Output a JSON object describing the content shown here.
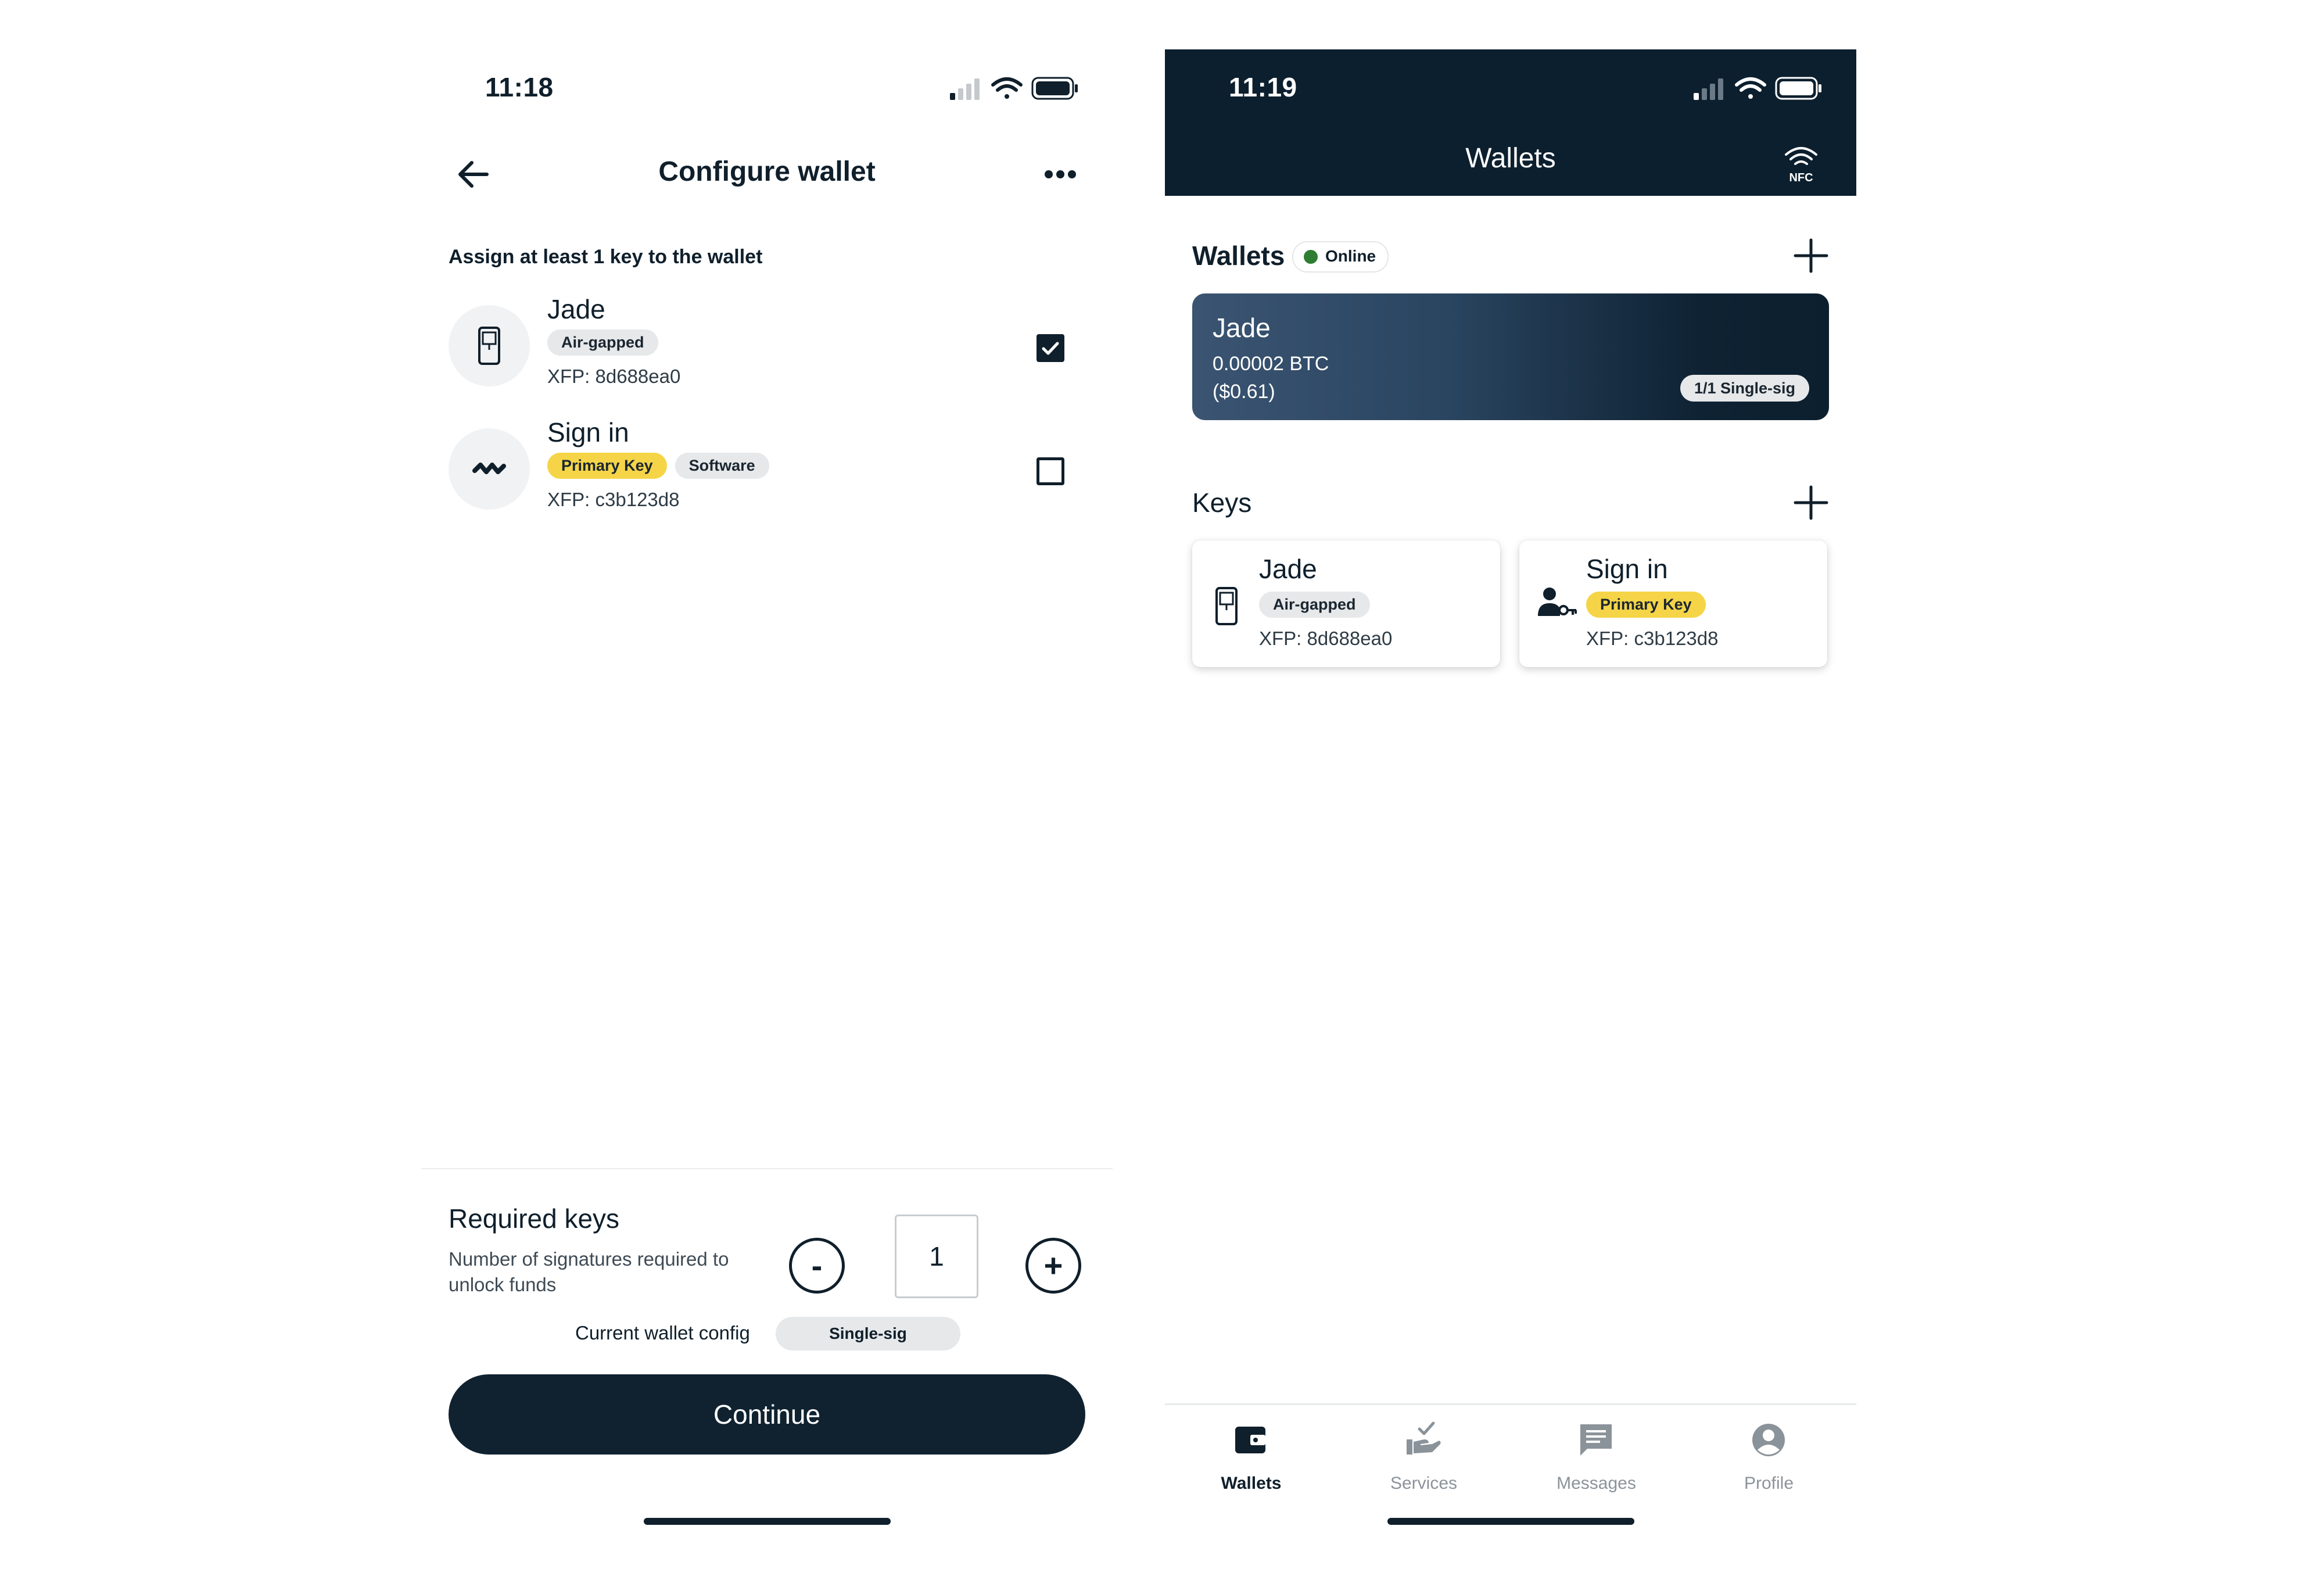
{
  "colors": {
    "navy": "#0c1f2e",
    "button_dark": "#102230",
    "chip_gray": "#e6e8ea",
    "primary_key_yellow": "#f5d547",
    "online_green": "#2e7d32",
    "tab_inactive": "#8b939a"
  },
  "configure_screen": {
    "status_time": "11:18",
    "header": {
      "title": "Configure wallet",
      "back_icon": "arrow-left-icon",
      "more_icon": "more-horizontal-icon"
    },
    "instruction": "Assign at least 1 key to the wallet",
    "keys": [
      {
        "name": "Jade",
        "icon": "hardware-device-icon",
        "chips": [
          "Air-gapped"
        ],
        "xfp": "XFP: 8d688ea0",
        "checked": true
      },
      {
        "name": "Sign in",
        "icon": "unchained-logo-icon",
        "chips": [
          "Primary Key",
          "Software"
        ],
        "xfp": "XFP: c3b123d8",
        "checked": false
      }
    ],
    "required_keys": {
      "title": "Required keys",
      "description": "Number of signatures required to unlock funds",
      "decrement_label": "-",
      "increment_label": "+",
      "value": "1"
    },
    "config": {
      "label": "Current wallet config",
      "value": "Single-sig"
    },
    "continue_label": "Continue"
  },
  "wallets_screen": {
    "status_time": "11:19",
    "header": {
      "title": "Wallets",
      "nfc_label": "NFC"
    },
    "wallets_section": {
      "title": "Wallets",
      "status": "Online",
      "add_icon": "plus-icon"
    },
    "wallet_card": {
      "name": "Jade",
      "balance": "0.00002 BTC",
      "fiat": "($0.61)",
      "type": "1/1 Single-sig"
    },
    "keys_section": {
      "title": "Keys",
      "add_icon": "plus-icon"
    },
    "key_cards": [
      {
        "name": "Jade",
        "icon": "hardware-device-icon",
        "chip": "Air-gapped",
        "xfp": "XFP: 8d688ea0"
      },
      {
        "name": "Sign in",
        "icon": "user-key-icon",
        "chip": "Primary Key",
        "xfp": "XFP: c3b123d8"
      }
    ],
    "tabs": [
      {
        "label": "Wallets",
        "icon": "wallet-icon",
        "active": true
      },
      {
        "label": "Services",
        "icon": "services-hand-icon",
        "active": false
      },
      {
        "label": "Messages",
        "icon": "message-icon",
        "active": false
      },
      {
        "label": "Profile",
        "icon": "profile-icon",
        "active": false
      }
    ]
  }
}
